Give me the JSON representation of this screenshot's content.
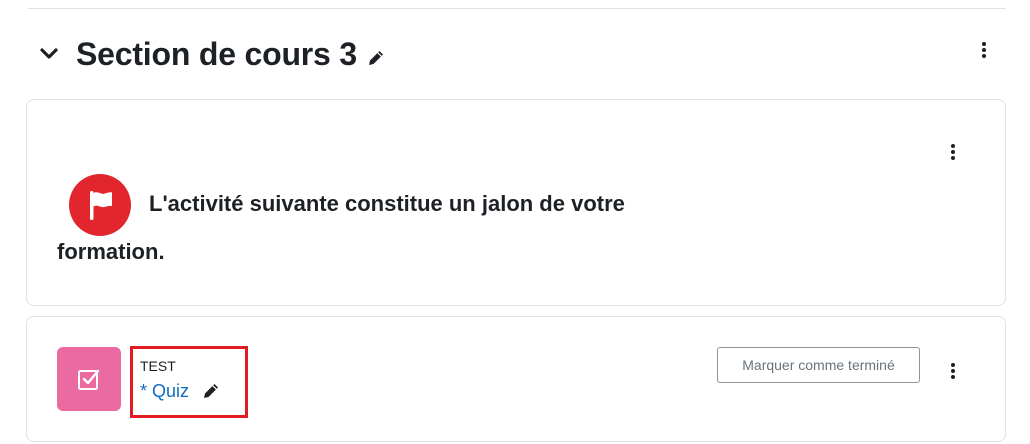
{
  "section": {
    "title": "Section de cours 3",
    "collapse_icon": "chevron-down-icon",
    "edit_icon": "pencil-icon",
    "menu_icon": "kebab-menu-icon"
  },
  "label_block": {
    "line1": "L'activité suivante constitue un jalon de votre",
    "line2": "formation.",
    "flag_icon": "flag-icon",
    "flag_color": "#e1262d"
  },
  "activity": {
    "type_label": "TEST",
    "name": "* Quiz",
    "icon": "quiz-checkbox-icon",
    "icon_color": "#ec6aa2",
    "link_color": "#0f6cbf",
    "highlight_color": "#e01b22",
    "mark_done_label": "Marquer comme terminé"
  }
}
